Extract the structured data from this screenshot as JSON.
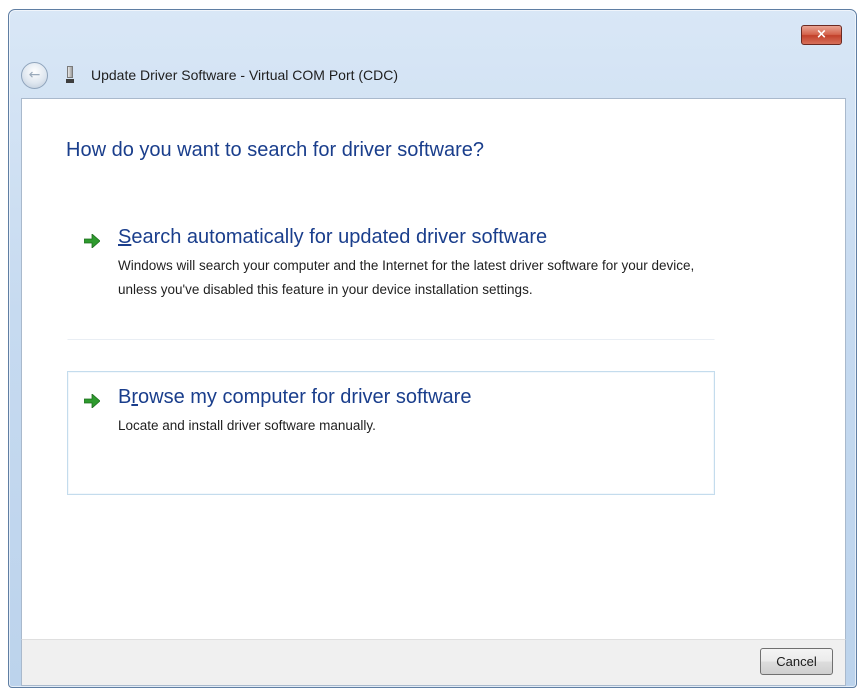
{
  "window": {
    "title": "Update Driver Software - Virtual COM Port (CDC)",
    "close_label": "×"
  },
  "main": {
    "heading": "How do you want to search for driver software?",
    "options": [
      {
        "mnemonic": "S",
        "title_rest": "earch automatically for updated driver software",
        "description": "Windows will search your computer and the Internet for the latest driver software for your device, unless you've disabled this feature in your device installation settings.",
        "icon": "green-arrow-icon"
      },
      {
        "title_first": "B",
        "mnemonic": "r",
        "title_rest": "owse my computer for driver software",
        "description": "Locate and install driver software manually.",
        "icon": "green-arrow-icon"
      }
    ]
  },
  "footer": {
    "cancel_label": "Cancel"
  },
  "colors": {
    "link_blue": "#1a3e8c",
    "arrow_green": "#2e9a2e",
    "close_red": "#c2402a"
  }
}
